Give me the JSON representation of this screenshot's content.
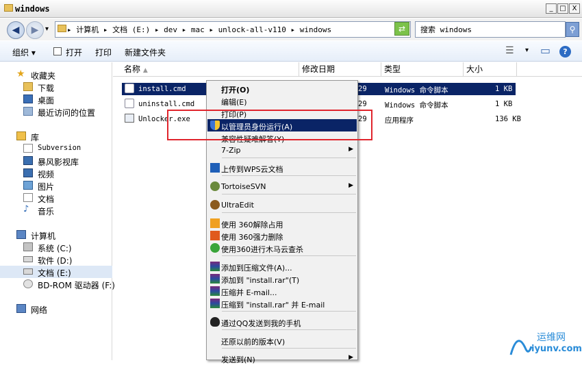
{
  "window": {
    "title": "windows",
    "min": "_",
    "max": "□",
    "close": "X"
  },
  "nav_buttons": {
    "back": "◀",
    "forward": "▶",
    "dropdown": "▾"
  },
  "address": {
    "text": "▸ 计算机 ▸ 文档 (E:) ▸ dev ▸ mac ▸ unlock-all-v110 ▸ windows"
  },
  "search": {
    "placeholder": "搜索 windows",
    "button": "⚲"
  },
  "toolbar": {
    "organize": "组织 ▾",
    "open": "打开",
    "print": "打印",
    "new_folder": "新建文件夹",
    "views": "☰",
    "preview": "▭",
    "help": "?"
  },
  "sidebar": {
    "favorites": "收藏夹",
    "downloads": "下载",
    "desktop": "桌面",
    "recent": "最近访问的位置",
    "libraries": "库",
    "subversion": "Subversion",
    "storm": "暴风影视库",
    "video": "视频",
    "pictures": "图片",
    "docs": "文档",
    "music": "音乐",
    "computer": "计算机",
    "sys": "系统 (C:)",
    "soft": "软件 (D:)",
    "doc": "文档 (E:)",
    "bd": "BD-ROM 驱动器 (F:)",
    "network": "网络"
  },
  "columns": {
    "name": "名称",
    "date": "修改日期",
    "type": "类型",
    "size": "大小"
  },
  "files": [
    {
      "name": "install.cmd",
      "date": "29",
      "type": "Windows 命令脚本",
      "size": "1 KB"
    },
    {
      "name": "uninstall.cmd",
      "date": "29",
      "type": "Windows 命令脚本",
      "size": "1 KB"
    },
    {
      "name": "Unlocker.exe",
      "date": "29",
      "type": "应用程序",
      "size": "136 KB"
    }
  ],
  "menu": [
    "打开(O)",
    "编辑(E)",
    "打印(P)",
    "以管理员身份运行(A)",
    "兼容性疑难解答(Y)",
    "7-Zip",
    "上传到WPS云文档",
    "TortoiseSVN",
    "UltraEdit",
    "使用 360解除占用",
    "使用 360强力删除",
    "使用360进行木马云查杀",
    "添加到压缩文件(A)...",
    "添加到 \"install.rar\"(T)",
    "压缩并 E-mail...",
    "压缩到 \"install.rar\" 并 E-mail",
    "通过QQ发送到我的手机",
    "还原以前的版本(V)",
    "发送到(N)"
  ],
  "watermark": {
    "cn": "运维网",
    "url": "iyunv.com"
  },
  "colors": {
    "selection": "#0a2466",
    "highlight_box": "#e0242c"
  }
}
